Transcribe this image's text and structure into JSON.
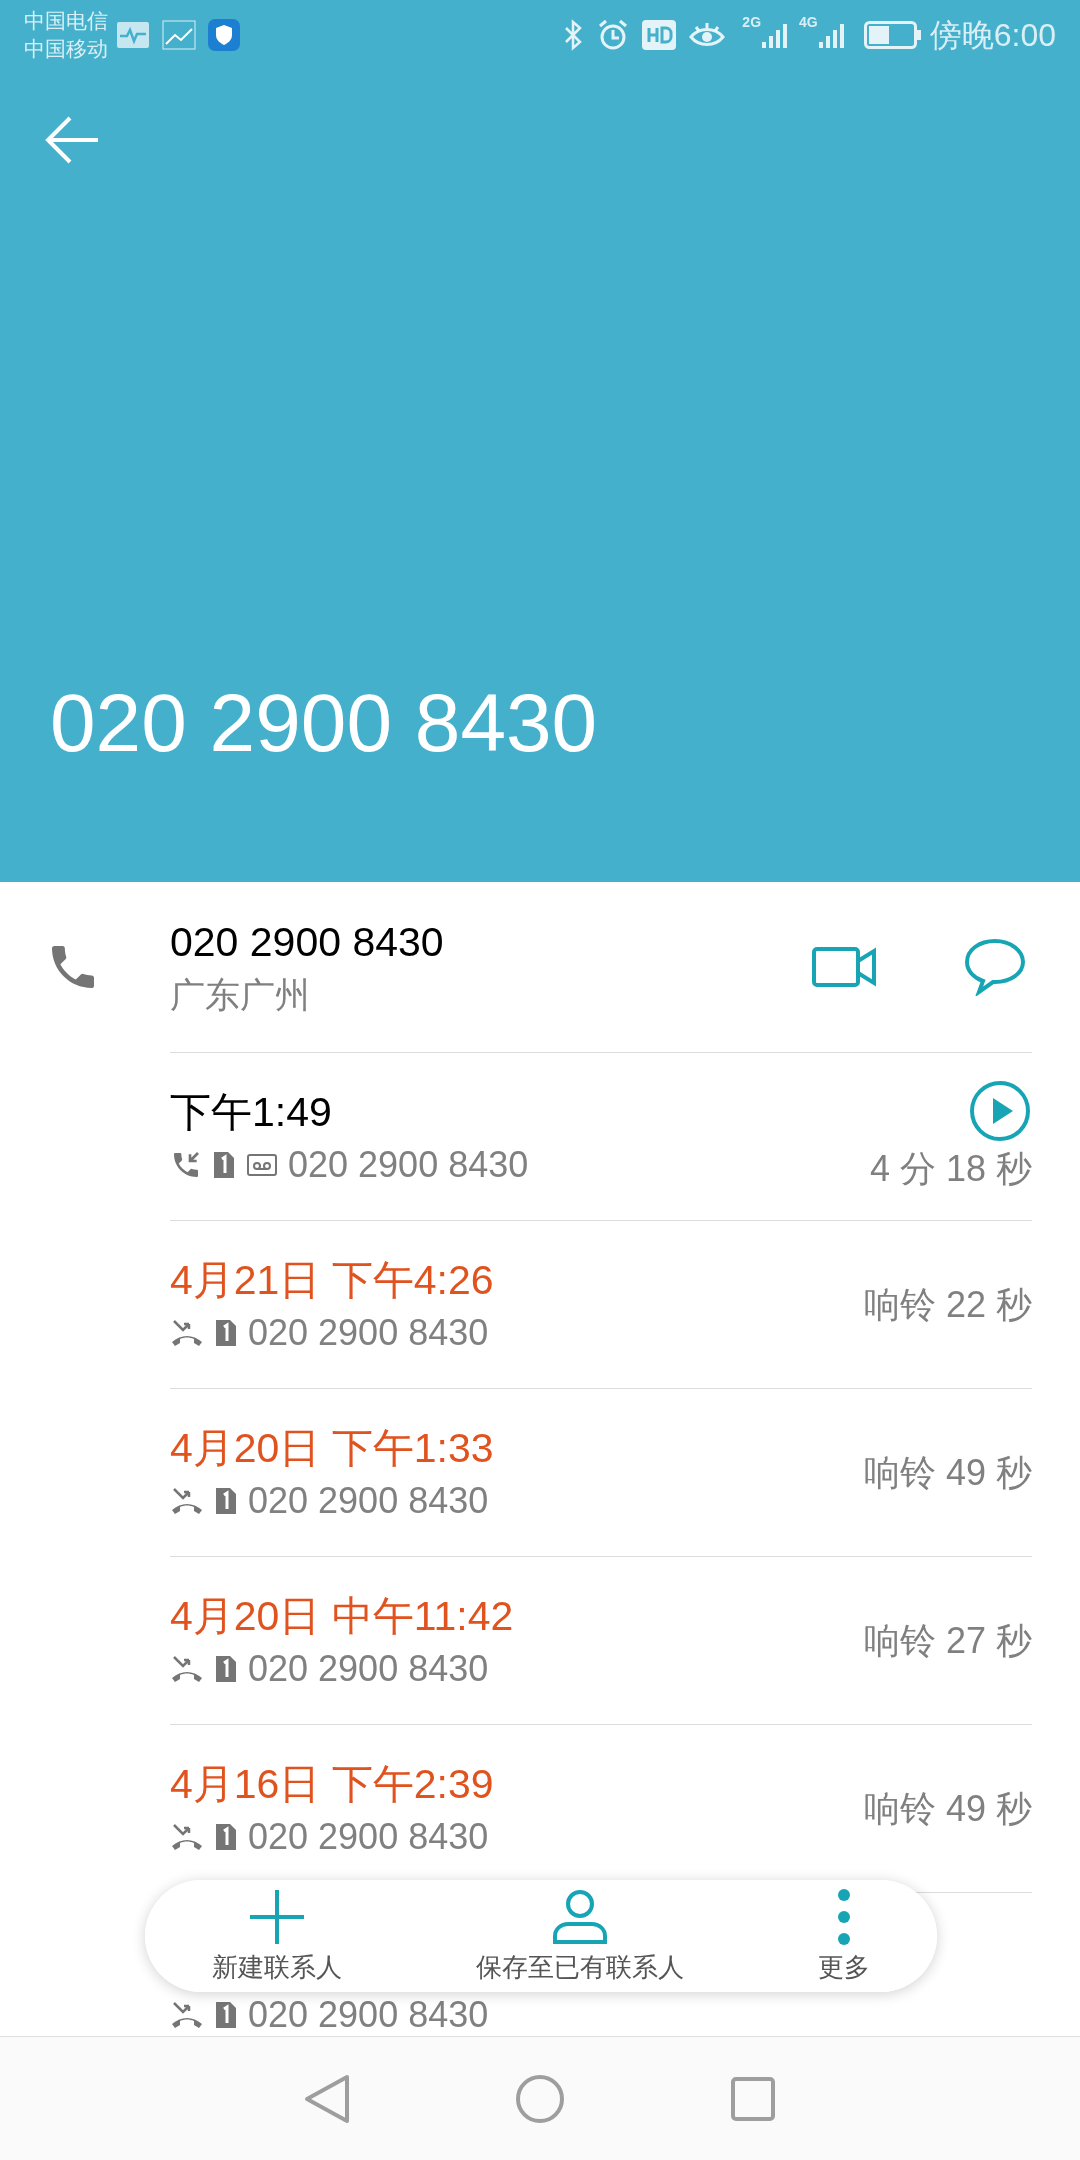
{
  "status_bar": {
    "carriers": [
      "中国电信",
      "中国移动"
    ],
    "network_labels": [
      "2G",
      "4G"
    ],
    "time": "傍晚6:00"
  },
  "header": {
    "number": "020 2900 8430"
  },
  "contact": {
    "number": "020 2900 8430",
    "location": "广东广州"
  },
  "calls": [
    {
      "kind": "answered",
      "time": "下午1:49",
      "number": "020 2900 8430",
      "duration": "4 分 18 秒",
      "voicemail": true
    },
    {
      "kind": "missed",
      "time": "4月21日 下午4:26",
      "number": "020 2900 8430",
      "duration": "响铃 22 秒",
      "voicemail": false
    },
    {
      "kind": "missed",
      "time": "4月20日 下午1:33",
      "number": "020 2900 8430",
      "duration": "响铃 49 秒",
      "voicemail": false
    },
    {
      "kind": "missed",
      "time": "4月20日 中午11:42",
      "number": "020 2900 8430",
      "duration": "响铃 27 秒",
      "voicemail": false
    },
    {
      "kind": "missed",
      "time": "4月16日 下午2:39",
      "number": "020 2900 8430",
      "duration": "响铃 49 秒",
      "voicemail": false
    },
    {
      "kind": "missed",
      "number": "020 2900 8430",
      "voicemail": false
    }
  ],
  "actions": [
    {
      "kind": "add",
      "label": "新建联系人"
    },
    {
      "kind": "person",
      "label": "保存至已有联系人"
    },
    {
      "kind": "more",
      "label": "更多"
    }
  ]
}
